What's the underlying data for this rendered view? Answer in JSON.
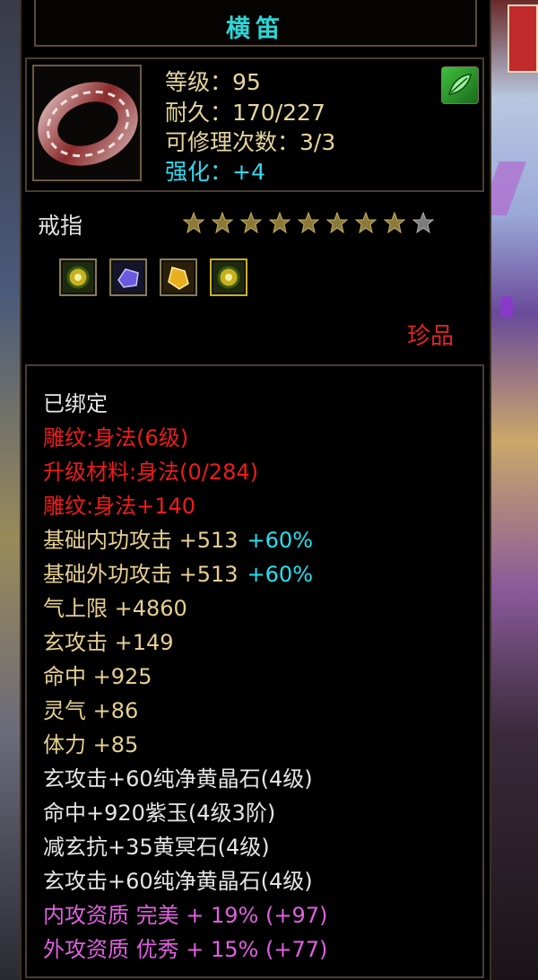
{
  "item": {
    "name": "横笛",
    "level": "等级：95",
    "durability": "耐久：170/227",
    "repair_count": "可修理次数：3/3",
    "enhance": "强化：+4",
    "type": "戒指",
    "stars_filled": 8,
    "stars_total": 9,
    "rarity": "珍品",
    "class_icon": "green-leaf-icon",
    "slot_gems": [
      "yellow-orb-gem-icon",
      "purple-crystal-gem-icon",
      "gold-crystal-gem-icon",
      "yellow-orb-gem-icon"
    ]
  },
  "attributes": [
    {
      "text": "已绑定",
      "color": "white"
    },
    {
      "text": "雕纹:身法(6级)",
      "color": "red"
    },
    {
      "text": "升级材料:身法(0/284)",
      "color": "red"
    },
    {
      "text": "雕纹:身法+140",
      "color": "red"
    },
    {
      "text": "基础内功攻击 +513",
      "pct": "+60%",
      "color": "gold"
    },
    {
      "text": "基础外功攻击 +513",
      "pct": "+60%",
      "color": "gold"
    },
    {
      "text": "气上限 +4860",
      "color": "gold"
    },
    {
      "text": "玄攻击 +149",
      "color": "gold"
    },
    {
      "text": "命中 +925",
      "color": "gold"
    },
    {
      "text": "灵气 +86",
      "color": "gold"
    },
    {
      "text": "体力 +85",
      "color": "gold"
    },
    {
      "text": "玄攻击+60纯净黄晶石(4级)",
      "color": "white"
    },
    {
      "text": "命中+920紫玉(4级3阶)",
      "color": "white"
    },
    {
      "text": "减玄抗+35黄冥石(4级)",
      "color": "white"
    },
    {
      "text": "玄攻击+60纯净黄晶石(4级)",
      "color": "white"
    },
    {
      "text": "内攻资质 完美 + 19% (+97)",
      "color": "pink"
    },
    {
      "text": "外攻资质 优秀 + 15% (+77)",
      "color": "pink"
    }
  ],
  "colors": {
    "title": "#2ed6d6",
    "enhance": "#33d8ee",
    "rarity": "#e02424",
    "red": "#ee1c1c",
    "gold": "#e6d090",
    "cyan": "#26e0ee",
    "pink": "#e060e0"
  }
}
